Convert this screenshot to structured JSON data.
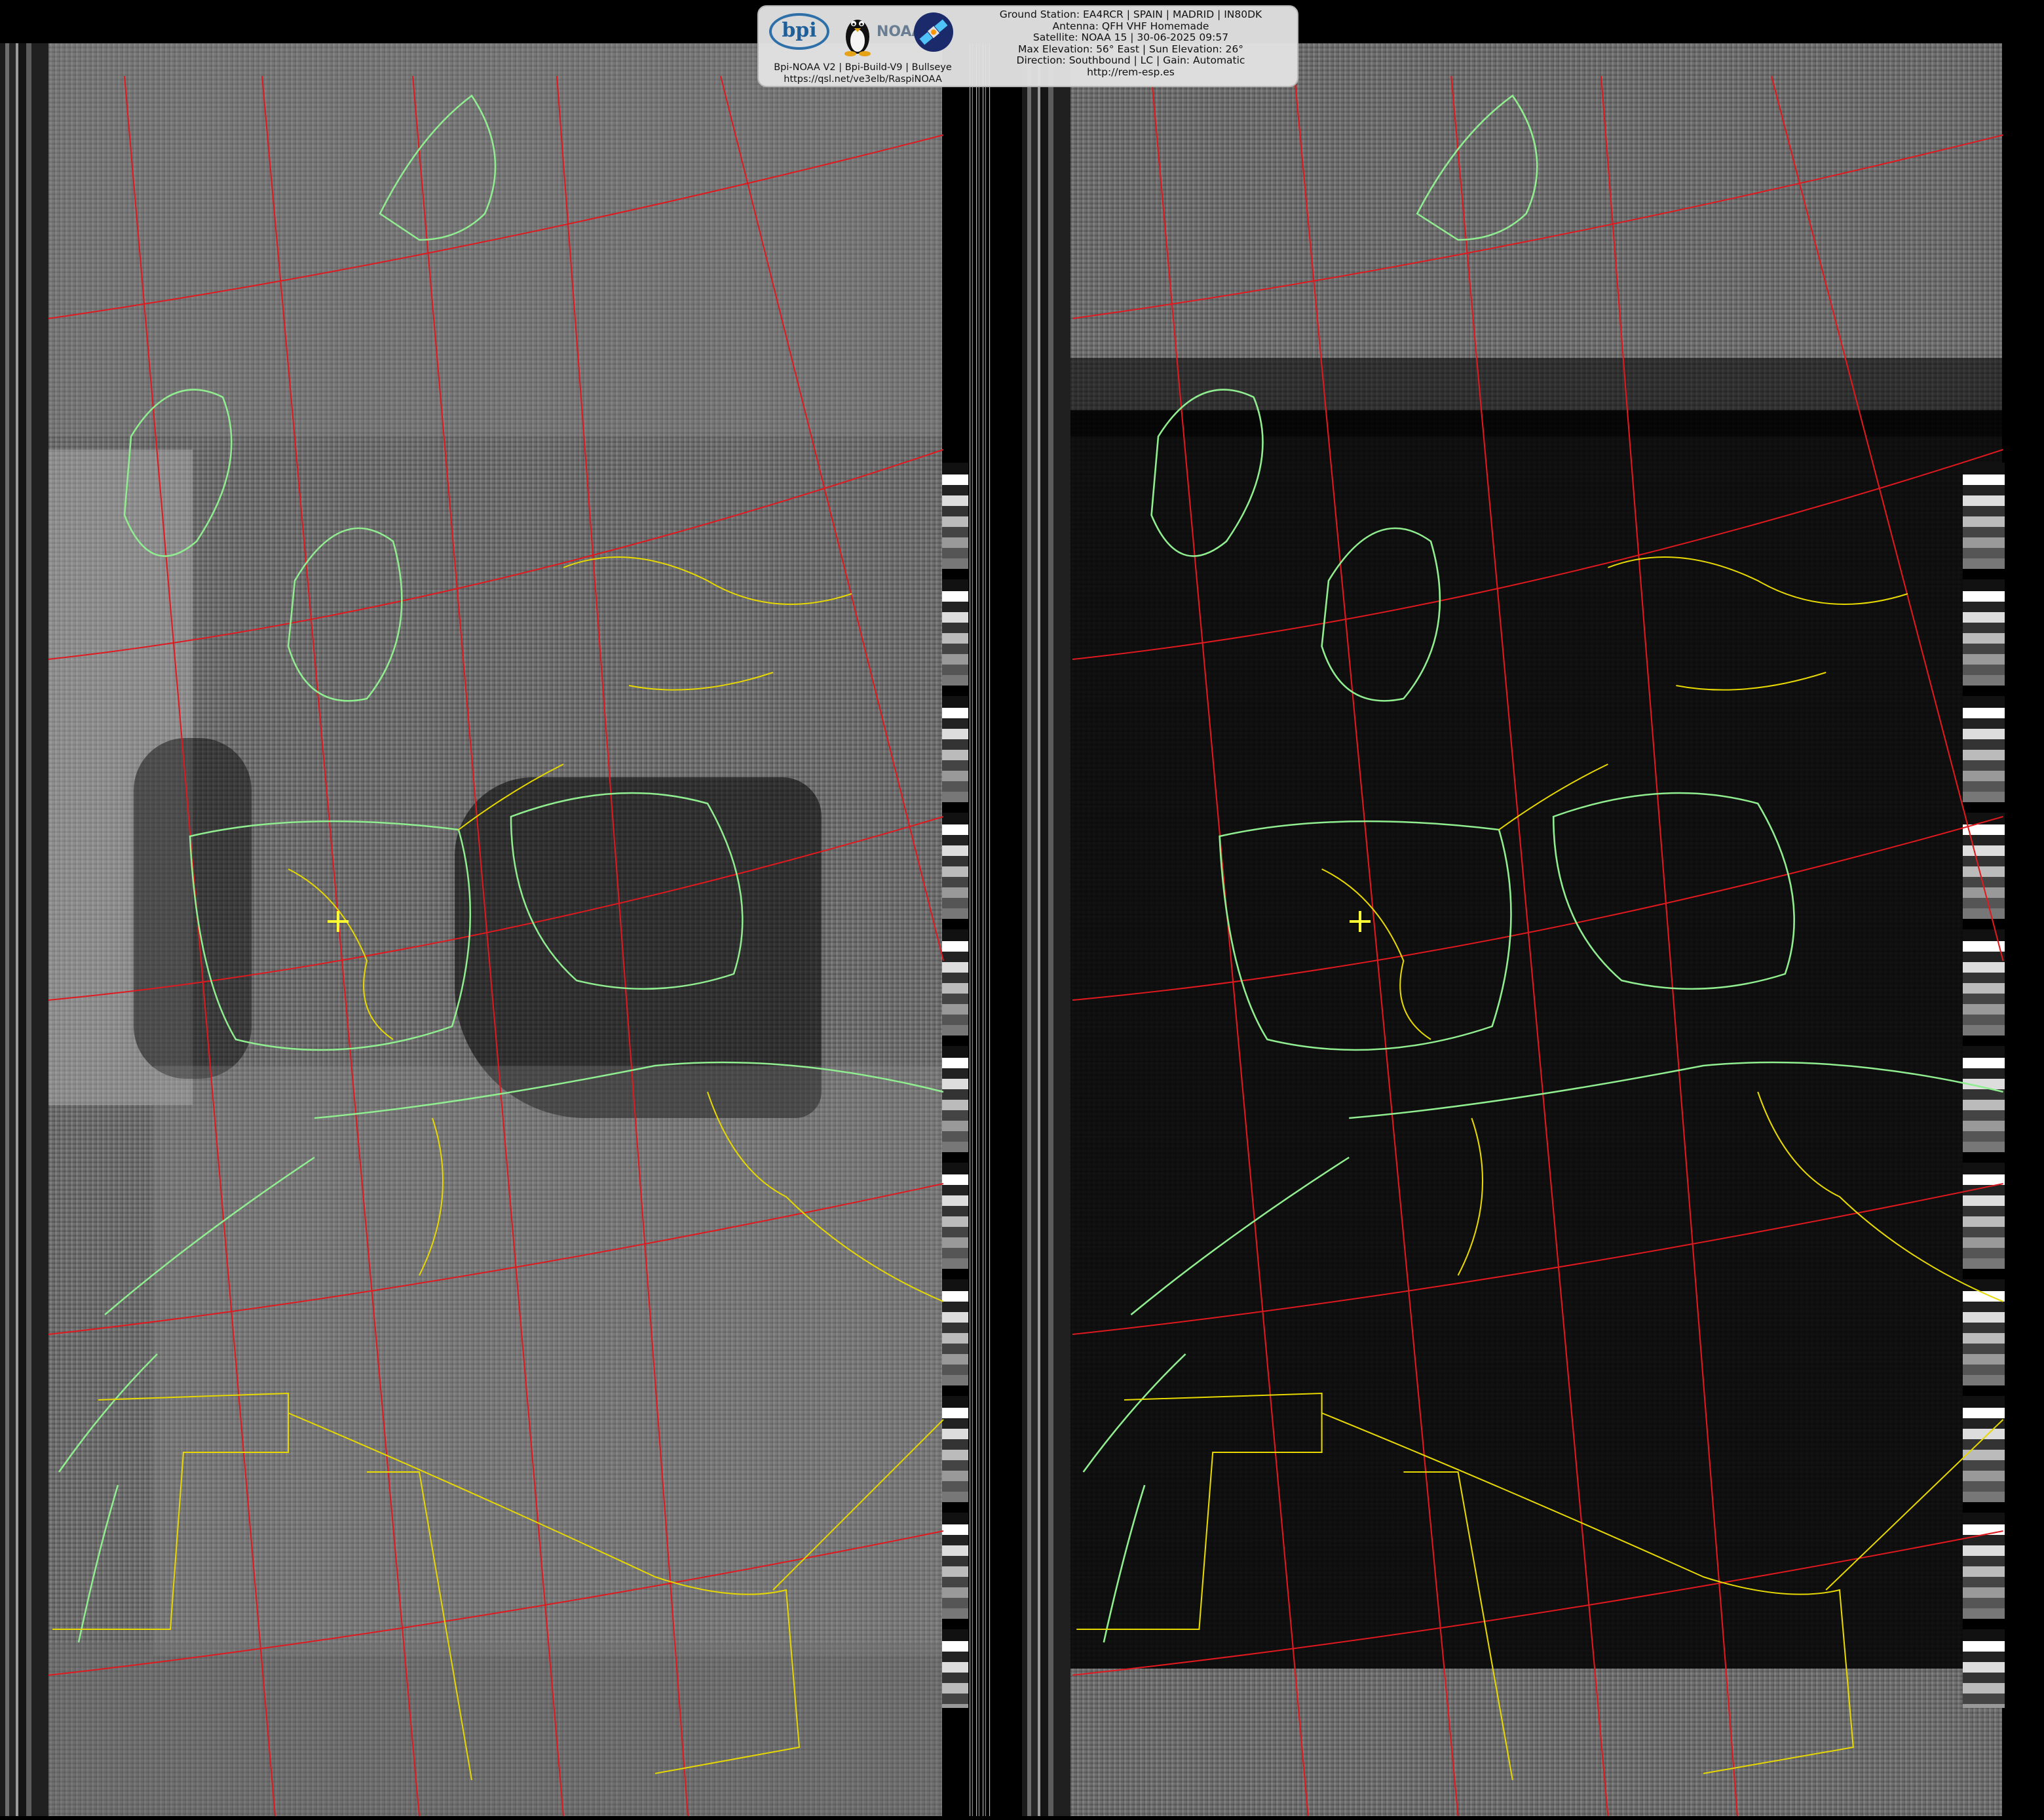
{
  "overlay": {
    "left_lines": [
      "Bpi-NOAA V2 | Bpi-Build-V9 | Bullseye",
      "https://qsl.net/ve3elb/RaspiNOAA"
    ],
    "logo_bpi": "bpi",
    "logo_noaa": "NOAA",
    "right_lines": [
      "Ground Station: EA4RCR | SPAIN | MADRID | IN80DK",
      "Antenna: QFH VHF Homemade",
      "Satellite: NOAA 15 | 30-06-2025 09:57",
      "Max Elevation: 56° East | Sun Elevation: 26°",
      "Direction: Southbound | LC | Gain: Automatic",
      "http://rem-esp.es"
    ]
  },
  "map": {
    "coastline_color": "#90ee90",
    "border_color": "#e6d800",
    "grid_color": "#e0191f",
    "marker_color": "#ffff33",
    "marker_symbol": "+"
  },
  "icons": [
    "bpi-logo",
    "tux-penguin-icon",
    "noaa-logo",
    "satellite-icon",
    "location-cross-icon"
  ]
}
